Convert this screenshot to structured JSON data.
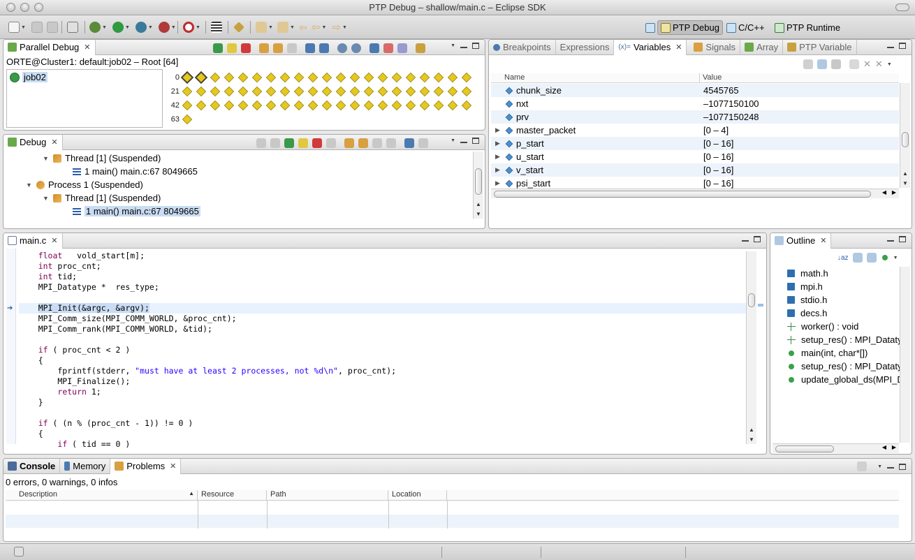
{
  "window": {
    "title": "PTP Debug – shallow/main.c – Eclipse SDK"
  },
  "perspectives": [
    {
      "label": "PTP Debug",
      "active": true
    },
    {
      "label": "C/C++",
      "active": false
    },
    {
      "label": "PTP Runtime",
      "active": false
    }
  ],
  "parallel_debug": {
    "tab": "Parallel Debug",
    "header": "ORTE@Cluster1: default:job02 – Root [64]",
    "job": "job02",
    "row_labels": [
      "0",
      "21",
      "42",
      "63"
    ],
    "process_count": 64
  },
  "debug": {
    "tab": "Debug",
    "rows": [
      {
        "text": "Thread [1] (Suspended)",
        "type": "thread",
        "expanded": true
      },
      {
        "text": "1 main() main.c:67 8049665",
        "type": "frame"
      },
      {
        "text": "Process 1 (Suspended)",
        "type": "process",
        "expanded": true
      },
      {
        "text": "Thread [1] (Suspended)",
        "type": "thread",
        "expanded": true
      },
      {
        "text": "1 main() main.c:67 8049665",
        "type": "frame",
        "selected": true
      }
    ]
  },
  "variables_panel": {
    "tabs": [
      "Breakpoints",
      "Expressions",
      "Variables",
      "Signals",
      "Array",
      "PTP Variable"
    ],
    "active_tab": "Variables",
    "columns": [
      "Name",
      "Value"
    ],
    "rows": [
      {
        "name": "chunk_size",
        "value": "4545765",
        "expandable": false
      },
      {
        "name": "nxt",
        "value": "–1077150100",
        "expandable": false
      },
      {
        "name": "prv",
        "value": "–1077150248",
        "expandable": false
      },
      {
        "name": "master_packet",
        "value": "[0 – 4]",
        "expandable": true
      },
      {
        "name": "p_start",
        "value": "[0 – 16]",
        "expandable": true
      },
      {
        "name": "u_start",
        "value": "[0 – 16]",
        "expandable": true
      },
      {
        "name": "v_start",
        "value": "[0 – 16]",
        "expandable": true
      },
      {
        "name": "psi_start",
        "value": "[0 – 16]",
        "expandable": true
      }
    ]
  },
  "editor": {
    "tab": "main.c",
    "lines": [
      "    float   vold_start[m];",
      "    int proc_cnt;",
      "    int tid;",
      "    MPI_Datatype *  res_type;",
      "",
      "    MPI_Init(&argc, &argv);",
      "    MPI_Comm_size(MPI_COMM_WORLD, &proc_cnt);",
      "    MPI_Comm_rank(MPI_COMM_WORLD, &tid);",
      "",
      "    if ( proc_cnt < 2 )",
      "    {",
      "        fprintf(stderr, \"must have at least 2 processes, not %d\\n\", proc_cnt);",
      "        MPI_Finalize();",
      "        return 1;",
      "    }",
      "",
      "    if ( (n % (proc_cnt - 1)) != 0 )",
      "    {",
      "        if ( tid == 0 )"
    ],
    "current_line_index": 5
  },
  "outline": {
    "tab": "Outline",
    "items": [
      {
        "label": "math.h",
        "kind": "include"
      },
      {
        "label": "mpi.h",
        "kind": "include"
      },
      {
        "label": "stdio.h",
        "kind": "include"
      },
      {
        "label": "decs.h",
        "kind": "include"
      },
      {
        "label": "worker() : void",
        "kind": "decl"
      },
      {
        "label": "setup_res() : MPI_Dataty",
        "kind": "decl"
      },
      {
        "label": "main(int, char*[])",
        "kind": "func"
      },
      {
        "label": "setup_res() : MPI_Dataty",
        "kind": "func"
      },
      {
        "label": "update_global_ds(MPI_D",
        "kind": "func"
      }
    ]
  },
  "bottom_panel": {
    "tabs": [
      "Console",
      "Memory",
      "Problems"
    ],
    "active_tab": "Problems",
    "summary": "0 errors, 0 warnings, 0 infos",
    "columns": [
      "Description",
      "Resource",
      "Path",
      "Location"
    ]
  }
}
